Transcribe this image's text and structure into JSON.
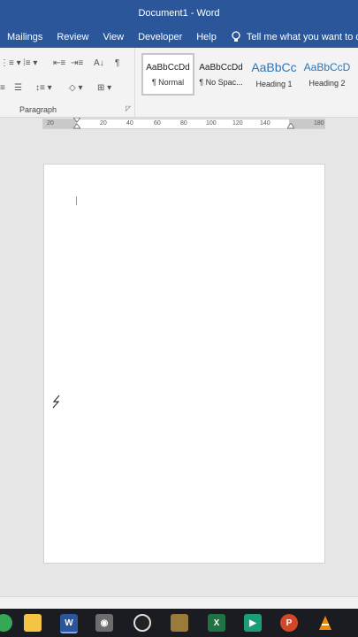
{
  "window": {
    "title": "Document1  -  Word"
  },
  "menu": {
    "tabs": [
      "Mailings",
      "Review",
      "View",
      "Developer",
      "Help"
    ],
    "tell_me": "Tell me what you want to do"
  },
  "ribbon": {
    "paragraph_label": "Paragraph",
    "styles": [
      {
        "preview": "AaBbCcDd",
        "name": "¶ Normal"
      },
      {
        "preview": "AaBbCcDd",
        "name": "¶ No Spac..."
      },
      {
        "preview": "AaBbCc",
        "name": "Heading 1"
      },
      {
        "preview": "AaBbCcD",
        "name": "Heading 2"
      }
    ]
  },
  "ruler": {
    "labels": [
      "20",
      "20",
      "40",
      "60",
      "80",
      "100",
      "120",
      "140",
      "180"
    ]
  },
  "taskbar": {
    "apps": [
      {
        "name": "chrome-icon",
        "color": "#34a853"
      },
      {
        "name": "file-explorer-icon",
        "color": "#f4c542"
      },
      {
        "name": "word-icon",
        "color": "#2b579a"
      },
      {
        "name": "camera-icon",
        "color": "#6d6d6d"
      },
      {
        "name": "speedometer-icon",
        "color": "#cc2222"
      },
      {
        "name": "game-icon",
        "color": "#9a7b3a"
      },
      {
        "name": "excel-icon",
        "color": "#217346"
      },
      {
        "name": "camtasia-icon",
        "color": "#1a9e7a"
      },
      {
        "name": "powerpoint-icon",
        "color": "#d24726"
      },
      {
        "name": "vlc-icon",
        "color": "#f08a00"
      }
    ]
  }
}
